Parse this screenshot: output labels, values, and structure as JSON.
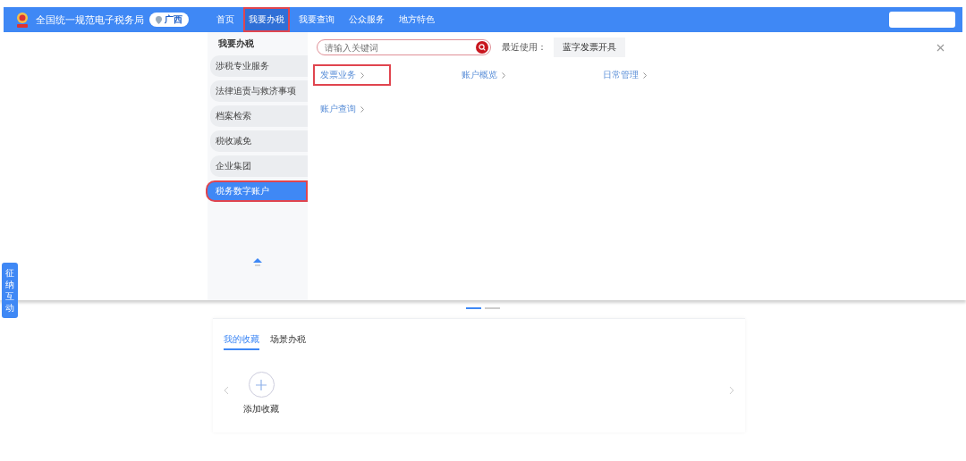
{
  "header": {
    "title": "全国统一规范电子税务局",
    "region": "广西",
    "nav": [
      {
        "label": "首页",
        "selected": false,
        "highlighted": false
      },
      {
        "label": "我要办税",
        "selected": true,
        "highlighted": true
      },
      {
        "label": "我要查询",
        "selected": false,
        "highlighted": false
      },
      {
        "label": "公众服务",
        "selected": false,
        "highlighted": false
      },
      {
        "label": "地方特色",
        "selected": false,
        "highlighted": false
      }
    ]
  },
  "menu": {
    "heading": "我要办税",
    "items": [
      {
        "label": "涉税专业服务",
        "selected": false,
        "highlighted": false
      },
      {
        "label": "法律追责与救济事项",
        "selected": false,
        "highlighted": false
      },
      {
        "label": "档案检索",
        "selected": false,
        "highlighted": false
      },
      {
        "label": "税收减免",
        "selected": false,
        "highlighted": false
      },
      {
        "label": "企业集团",
        "selected": false,
        "highlighted": false
      },
      {
        "label": "税务数字账户",
        "selected": true,
        "highlighted": true
      }
    ],
    "search": {
      "placeholder": "请输入关键词"
    },
    "recent_label": "最近使用：",
    "recent": [
      "蓝字发票开具"
    ],
    "links": [
      {
        "label": "发票业务",
        "highlighted": true
      },
      {
        "label": "账户概览",
        "highlighted": false
      },
      {
        "label": "日常管理",
        "highlighted": false
      },
      {
        "label": "账户查询",
        "highlighted": false
      }
    ]
  },
  "side_tab": "征纳互动",
  "carousel": {
    "dots": [
      {
        "selected": true
      },
      {
        "selected": false
      }
    ]
  },
  "favorites": {
    "tabs": [
      {
        "label": "我的收藏",
        "selected": true
      },
      {
        "label": "场景办税",
        "selected": false
      }
    ],
    "add_label": "添加收藏"
  }
}
